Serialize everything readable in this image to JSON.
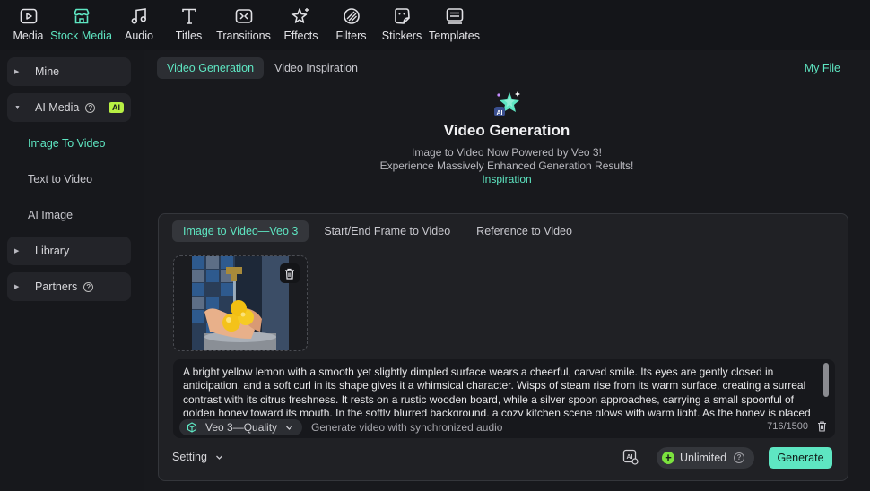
{
  "toolbar": {
    "items": [
      {
        "label": "Media",
        "icon": "media-icon"
      },
      {
        "label": "Stock Media",
        "icon": "stock-media-icon",
        "active": true
      },
      {
        "label": "Audio",
        "icon": "music-note-icon"
      },
      {
        "label": "Titles",
        "icon": "text-t-icon"
      },
      {
        "label": "Transitions",
        "icon": "transitions-icon"
      },
      {
        "label": "Effects",
        "icon": "sparkle-effects-icon"
      },
      {
        "label": "Filters",
        "icon": "filters-icon"
      },
      {
        "label": "Stickers",
        "icon": "sticker-icon"
      },
      {
        "label": "Templates",
        "icon": "templates-icon"
      }
    ]
  },
  "sidebar": {
    "mine": "Mine",
    "ai_media": "AI Media",
    "ai_badge": "AI",
    "ai_items": [
      "Image To Video",
      "Text to Video",
      "AI Image"
    ],
    "library": "Library",
    "partners": "Partners"
  },
  "main": {
    "tabs": [
      "Video Generation",
      "Video Inspiration"
    ],
    "my_file": "My File",
    "hero": {
      "title": "Video Generation",
      "line1": "Image to Video Now Powered by Veo 3!",
      "line2": "Experience Massively Enhanced Generation Results!",
      "link": "Inspiration"
    },
    "sub_tabs": [
      "Image to Video—Veo 3",
      "Start/End Frame to Video",
      "Reference to Video"
    ],
    "prompt": "A bright yellow lemon with a smooth yet slightly dimpled surface wears a cheerful, carved smile. Its eyes are gently closed in anticipation, and a soft curl in its shape gives it a whimsical character. Wisps of steam rise from its warm surface, creating a surreal contrast with its citrus freshness. It rests on a rustic wooden board, while a silver spoon approaches, carrying a small spoonful of golden honey toward its mouth. In the softly blurred background, a cozy kitchen scene glows with warm light. As the honey is placed",
    "model": "Veo 3—Quality",
    "model_hint": "Generate video with synchronized audio",
    "char_count": "716/1500",
    "setting": "Setting",
    "unlimited": "Unlimited",
    "generate": "Generate"
  },
  "colors": {
    "accent": "#5ee6c2",
    "background": "#18191d",
    "ai_badge": "#b8f044",
    "unlimited_plus": "#7be23e"
  }
}
